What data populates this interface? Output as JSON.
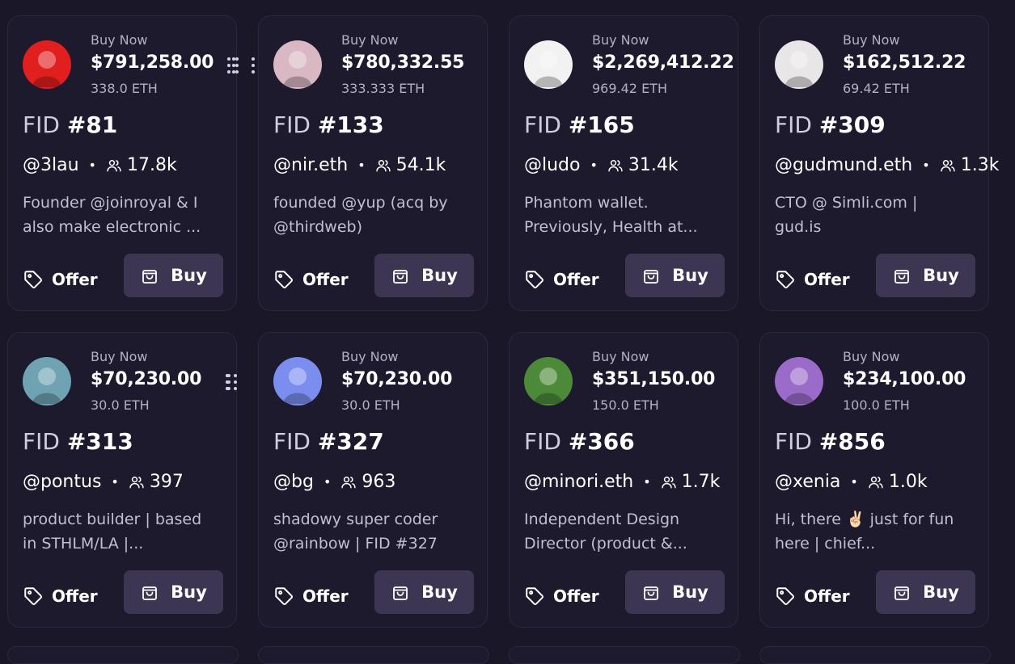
{
  "cards": [
    {
      "buy_now": "Buy Now",
      "price": "$791,258.00",
      "eth": "338.0 ETH",
      "fid_prefix": "FID",
      "fid_number": "#81",
      "handle": "@3lau",
      "followers": "17.8k",
      "bio": "Founder @joinroyal & I\nalso make electronic ...",
      "offer": "Offer",
      "buy": "Buy",
      "avatar_color": "#e21f1f"
    },
    {
      "buy_now": "Buy Now",
      "price": "$780,332.55",
      "eth": "333.333 ETH",
      "fid_prefix": "FID",
      "fid_number": "#133",
      "handle": "@nir.eth",
      "followers": "54.1k",
      "bio": "founded @yup (acq by\n@thirdweb)",
      "offer": "Offer",
      "buy": "Buy",
      "avatar_color": "#d9b8c3"
    },
    {
      "buy_now": "Buy Now",
      "price": "$2,269,412.22",
      "eth": "969.42 ETH",
      "fid_prefix": "FID",
      "fid_number": "#165",
      "handle": "@ludo",
      "followers": "31.4k",
      "bio": "Phantom wallet.\nPreviously, Health at...",
      "offer": "Offer",
      "buy": "Buy",
      "avatar_color": "#f2f2f2"
    },
    {
      "buy_now": "Buy Now",
      "price": "$162,512.22",
      "eth": "69.42 ETH",
      "fid_prefix": "FID",
      "fid_number": "#309",
      "handle": "@gudmund.eth",
      "followers": "1.3k",
      "bio": "CTO @ Simli.com |\ngud.is",
      "offer": "Offer",
      "buy": "Buy",
      "avatar_color": "#e8e6e6"
    },
    {
      "buy_now": "Buy Now",
      "price": "$70,230.00",
      "eth": "30.0 ETH",
      "fid_prefix": "FID",
      "fid_number": "#313",
      "handle": "@pontus",
      "followers": "397",
      "bio": "product builder | based\nin STHLM/LA |...",
      "offer": "Offer",
      "buy": "Buy",
      "avatar_color": "#6fa3b3"
    },
    {
      "buy_now": "Buy Now",
      "price": "$70,230.00",
      "eth": "30.0 ETH",
      "fid_prefix": "FID",
      "fid_number": "#327",
      "handle": "@bg",
      "followers": "963",
      "bio": "shadowy super coder\n@rainbow | FID #327",
      "offer": "Offer",
      "buy": "Buy",
      "avatar_color": "#7b8ef0"
    },
    {
      "buy_now": "Buy Now",
      "price": "$351,150.00",
      "eth": "150.0 ETH",
      "fid_prefix": "FID",
      "fid_number": "#366",
      "handle": "@minori.eth",
      "followers": "1.7k",
      "bio": "Independent Design\nDirector (product &...",
      "offer": "Offer",
      "buy": "Buy",
      "avatar_color": "#4c8a3a"
    },
    {
      "buy_now": "Buy Now",
      "price": "$234,100.00",
      "eth": "100.0 ETH",
      "fid_prefix": "FID",
      "fid_number": "#856",
      "handle": "@xenia",
      "followers": "1.0k",
      "bio": "Hi, there ✌🏻 just for fun\nhere | chief...",
      "offer": "Offer",
      "buy": "Buy",
      "avatar_color": "#9b6bc9"
    }
  ],
  "icons": {
    "menu": "more-vertical-icon",
    "followers": "users-icon",
    "offer": "tag-icon",
    "buy": "shopping-bag-icon"
  },
  "colors": {
    "background": "#1a1729",
    "card": "#1c1a2c",
    "buy_button": "#3c3653",
    "muted_text": "#b3b0c6"
  }
}
